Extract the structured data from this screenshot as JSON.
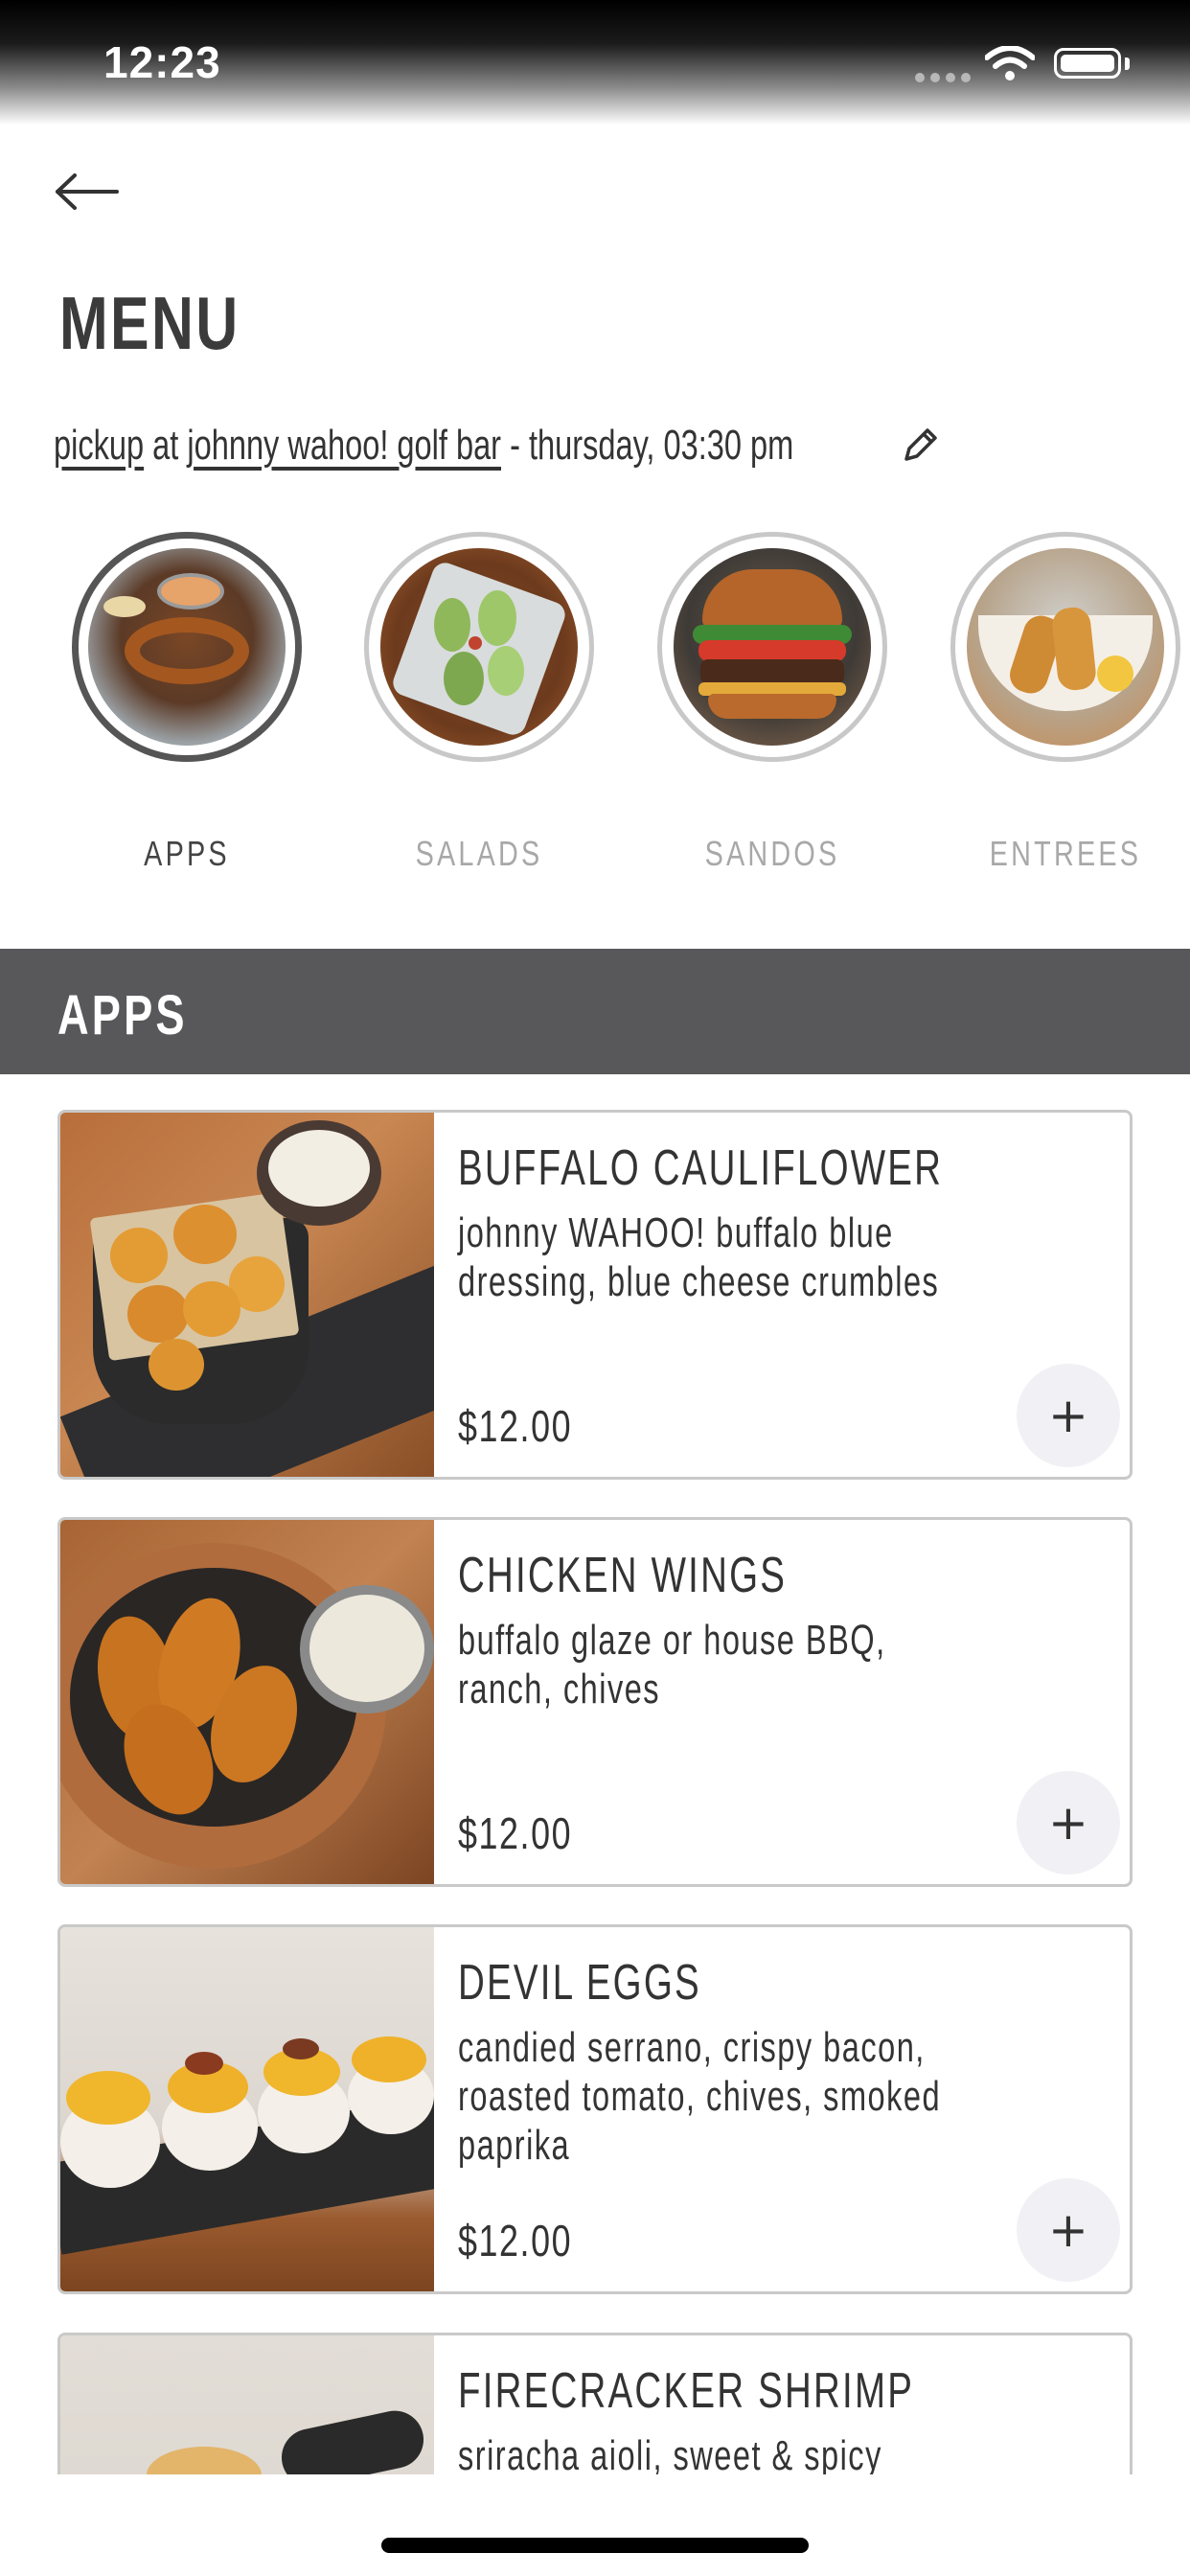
{
  "status": {
    "time": "12:23"
  },
  "header": {
    "title": "MENU",
    "mode": "pickup",
    "at": "at",
    "location": "johnny wahoo! golf bar",
    "datetime": "- thursday, 03:30 pm"
  },
  "categories": [
    {
      "label": "APPS",
      "active": true
    },
    {
      "label": "SALADS",
      "active": false
    },
    {
      "label": "SANDOS",
      "active": false
    },
    {
      "label": "ENTREES",
      "active": false
    }
  ],
  "section": {
    "title": "APPS"
  },
  "items": [
    {
      "name": "BUFFALO CAULIFLOWER",
      "description": "johnny WAHOO! buffalo blue dressing, blue cheese crumbles",
      "price": "$12.00",
      "add_icon": "+"
    },
    {
      "name": "CHICKEN WINGS",
      "description": "buffalo glaze or house BBQ, ranch, chives",
      "price": "$12.00",
      "add_icon": "+"
    },
    {
      "name": "DEVIL EGGS",
      "description": "candied serrano, crispy bacon, roasted tomato, chives, smoked paprika",
      "price": "$12.00",
      "add_icon": "+"
    },
    {
      "name": "FIRECRACKER SHRIMP",
      "description": "sriracha aioli, sweet & spicy mango",
      "price": "",
      "add_icon": ""
    }
  ]
}
